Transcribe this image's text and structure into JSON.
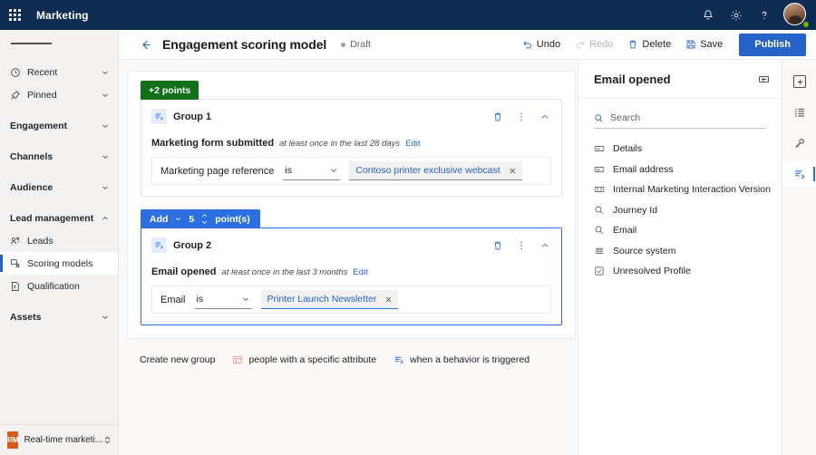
{
  "topbar": {
    "waffle_icon": "app-launcher-icon",
    "app_title": "Marketing",
    "actions": [
      {
        "name": "notifications-icon",
        "label": "Notifications"
      },
      {
        "name": "settings-gear-icon",
        "label": "Settings"
      },
      {
        "name": "help-icon",
        "label": "Help"
      }
    ],
    "avatar": "user-avatar",
    "presence": "available"
  },
  "sidebar": {
    "hamburger": "menu-icon",
    "items": [
      {
        "label": "Recent",
        "icon": "clock-icon",
        "type": "expandable",
        "chevron": "down"
      },
      {
        "label": "Pinned",
        "icon": "pin-icon",
        "type": "expandable",
        "chevron": "down"
      },
      {
        "label": "Engagement",
        "icon": "",
        "type": "group-header",
        "chevron": "down"
      },
      {
        "label": "Channels",
        "icon": "",
        "type": "group-header",
        "chevron": "down"
      },
      {
        "label": "Audience",
        "icon": "",
        "type": "group-header",
        "chevron": "down"
      },
      {
        "label": "Lead management",
        "icon": "",
        "type": "group-header",
        "chevron": "up"
      },
      {
        "label": "Leads",
        "icon": "leads-icon",
        "type": "link"
      },
      {
        "label": "Scoring models",
        "icon": "scoring-models-icon",
        "type": "link",
        "selected": true
      },
      {
        "label": "Qualification",
        "icon": "qualification-icon",
        "type": "link"
      },
      {
        "label": "Assets",
        "icon": "",
        "type": "group-header",
        "chevron": "down"
      }
    ],
    "area_switcher": {
      "badge": "RM",
      "label": "Real-time marketi...",
      "badge_color": "#d65a1b"
    }
  },
  "commandbar": {
    "back_icon": "back-arrow-icon",
    "title": "Engagement scoring model",
    "status": "Draft",
    "buttons": [
      {
        "label": "Undo",
        "icon": "undo-icon",
        "disabled": false
      },
      {
        "label": "Redo",
        "icon": "redo-icon",
        "disabled": true
      },
      {
        "label": "Delete",
        "icon": "trash-icon",
        "disabled": false
      },
      {
        "label": "Save",
        "icon": "save-icon",
        "disabled": false
      }
    ],
    "publish_label": "Publish",
    "publish_color": "#2563c9"
  },
  "canvas": {
    "groups": [
      {
        "tag": {
          "text": "+2 points",
          "color": "#0f7019",
          "kind": "static"
        },
        "name": "Group 1",
        "icon": "behavior-trigger-icon",
        "actions": [
          "trash-icon",
          "more-vertical-icon",
          "collapse-chevron-up-icon"
        ],
        "condition": {
          "name": "Marketing form submitted",
          "frequency": "at least once in the last 28 days",
          "edit_label": "Edit"
        },
        "filter": {
          "label": "Marketing page reference",
          "operator": "is",
          "value": "Contoso printer exclusive webcast",
          "remove_icon": "close-icon"
        },
        "active": false
      },
      {
        "tag": {
          "text_prefix": "Add",
          "points": "5",
          "text_suffix": "point(s)",
          "color": "#2b6fe0",
          "kind": "editor"
        },
        "name": "Group 2",
        "icon": "behavior-trigger-icon",
        "actions": [
          "trash-icon",
          "more-vertical-icon",
          "collapse-chevron-up-icon"
        ],
        "condition": {
          "name": "Email opened",
          "frequency": "at least once in the last 3 months",
          "edit_label": "Edit"
        },
        "filter": {
          "label": "Email",
          "operator": "is",
          "value": "Printer Launch Newsletter",
          "remove_icon": "close-icon"
        },
        "active": true
      }
    ],
    "create_row": {
      "label": "Create new group",
      "options": [
        {
          "label": "people with a specific attribute",
          "icon": "attribute-icon"
        },
        {
          "label": "when a behavior is triggered",
          "icon": "behavior-trigger-icon"
        }
      ]
    }
  },
  "right_panel": {
    "title": "Email opened",
    "collapse_icon": "collapse-panel-icon",
    "search_placeholder": "Search",
    "search_value": "",
    "search_icon": "search-icon",
    "items": [
      {
        "label": "Details",
        "icon": "text-field-icon"
      },
      {
        "label": "Email address",
        "icon": "text-field-icon"
      },
      {
        "label": "Internal Marketing Interaction Version",
        "icon": "multi-field-icon"
      },
      {
        "label": "Journey Id",
        "icon": "lookup-icon"
      },
      {
        "label": "Email",
        "icon": "lookup-icon"
      },
      {
        "label": "Source system",
        "icon": "list-icon"
      },
      {
        "label": "Unresolved Profile",
        "icon": "checkbox-icon"
      }
    ]
  },
  "rail": {
    "buttons": [
      {
        "name": "add-box-icon",
        "selected": false
      },
      {
        "name": "list-icon",
        "selected": false
      },
      {
        "name": "key-properties-icon",
        "selected": false
      },
      {
        "name": "behavior-trigger-icon",
        "selected": true
      }
    ]
  }
}
